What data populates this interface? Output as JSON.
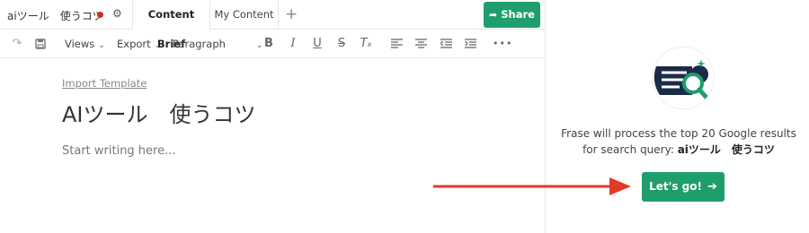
{
  "document": {
    "title": "aiツール　使うコツ",
    "unsaved_dot_color": "#d62b20",
    "settings_icon": "gear-icon"
  },
  "tabs": {
    "content_brief": "Content Brief",
    "my_content": "My Content",
    "add": "+"
  },
  "share": {
    "label": "Share",
    "icon": "share-arrow-icon",
    "color": "#1e9e6b"
  },
  "toolbar": {
    "views": "Views",
    "export": "Export",
    "paragraph": "Paragraph",
    "more": "•••"
  },
  "editor": {
    "import_template": "Import Template",
    "heading": "AIツール　使うコツ",
    "placeholder": "Start writing here..."
  },
  "brief": {
    "line1": "Frase will process the top 20 Google results",
    "line2_prefix": "for search query: ",
    "query": "aiツール　使うコツ",
    "button": "Let's go!",
    "button_color": "#1e9e6b"
  },
  "annotation": {
    "arrow_color": "#e53a2a"
  }
}
